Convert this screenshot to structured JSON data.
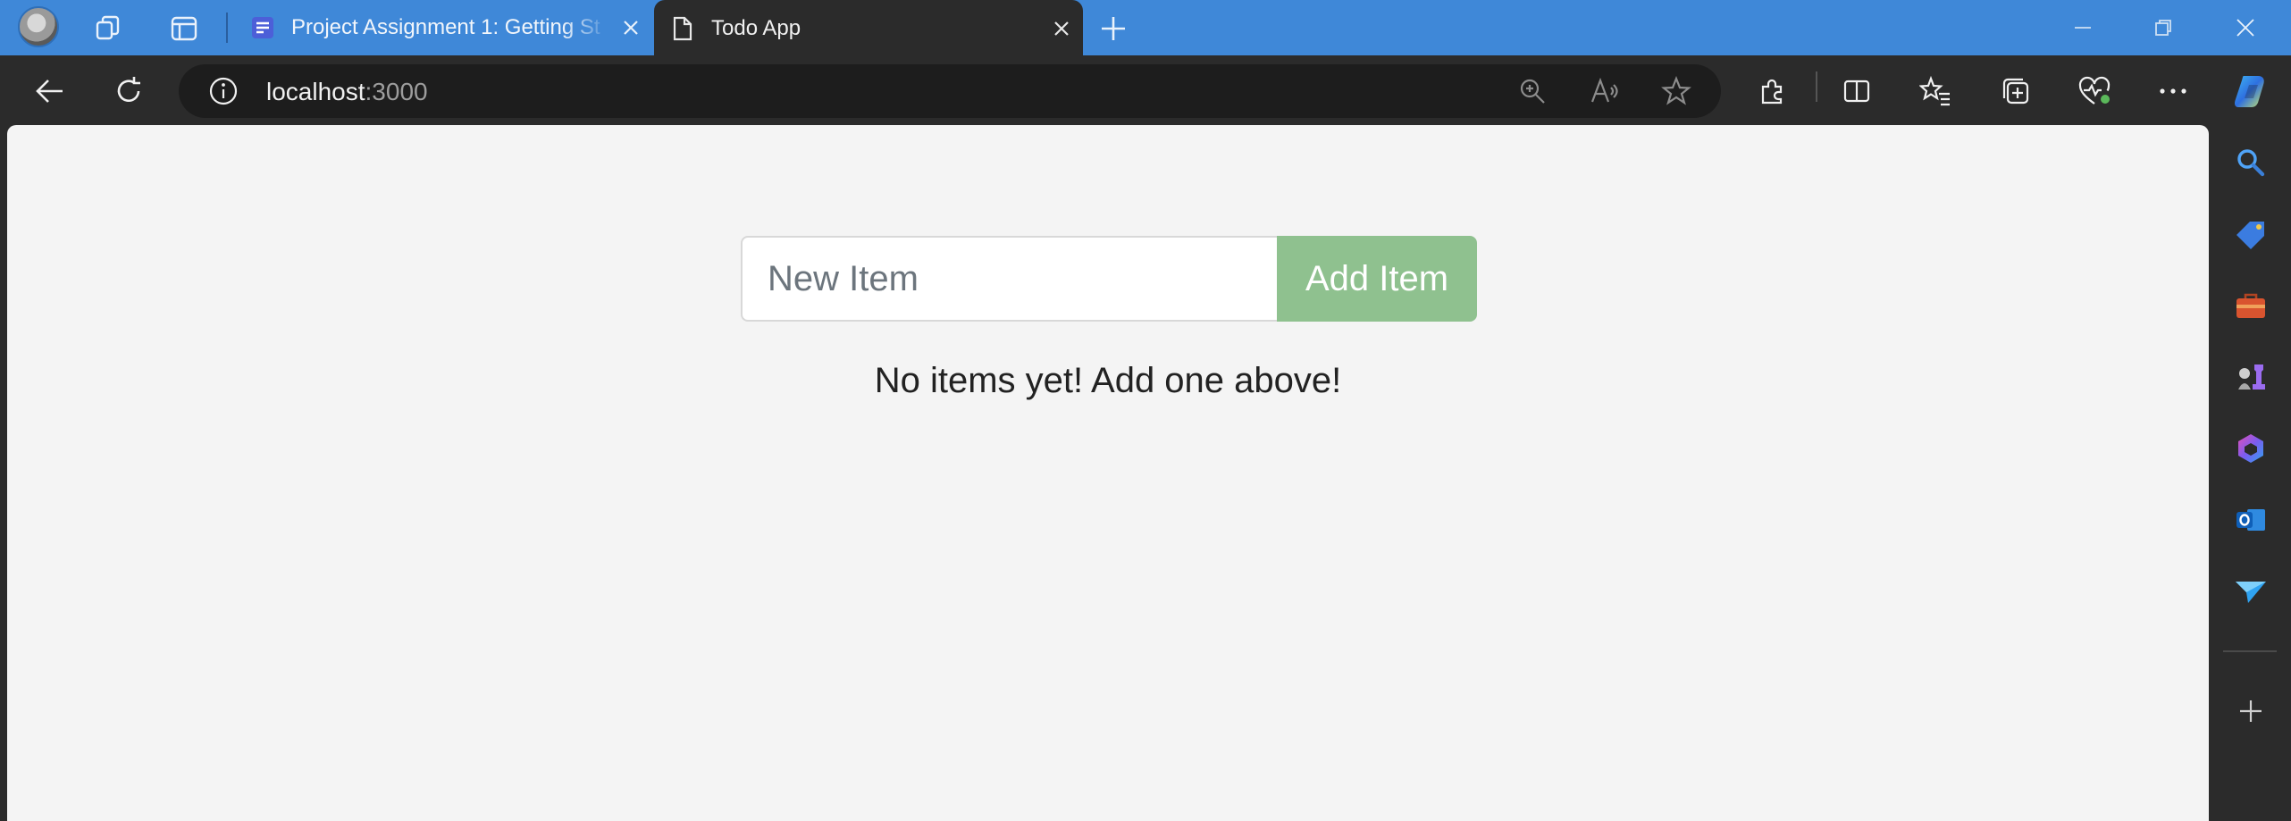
{
  "browser": {
    "tabs": [
      {
        "title": "Project Assignment 1: Getting St",
        "active": false,
        "icon": "doc-lines-icon"
      },
      {
        "title": "Todo App",
        "active": true,
        "icon": "page-icon"
      }
    ],
    "address": {
      "host": "localhost",
      "port": ":3000"
    },
    "colors": {
      "tabbar": "#3f88d8",
      "chrome": "#2b2b2b",
      "omnibox": "#1d1d1d"
    }
  },
  "todo": {
    "input_placeholder": "New Item",
    "add_button_label": "Add Item",
    "empty_message": "No items yet! Add one above!",
    "colors": {
      "button": "#8fc18f",
      "background": "#f4f4f4"
    }
  }
}
